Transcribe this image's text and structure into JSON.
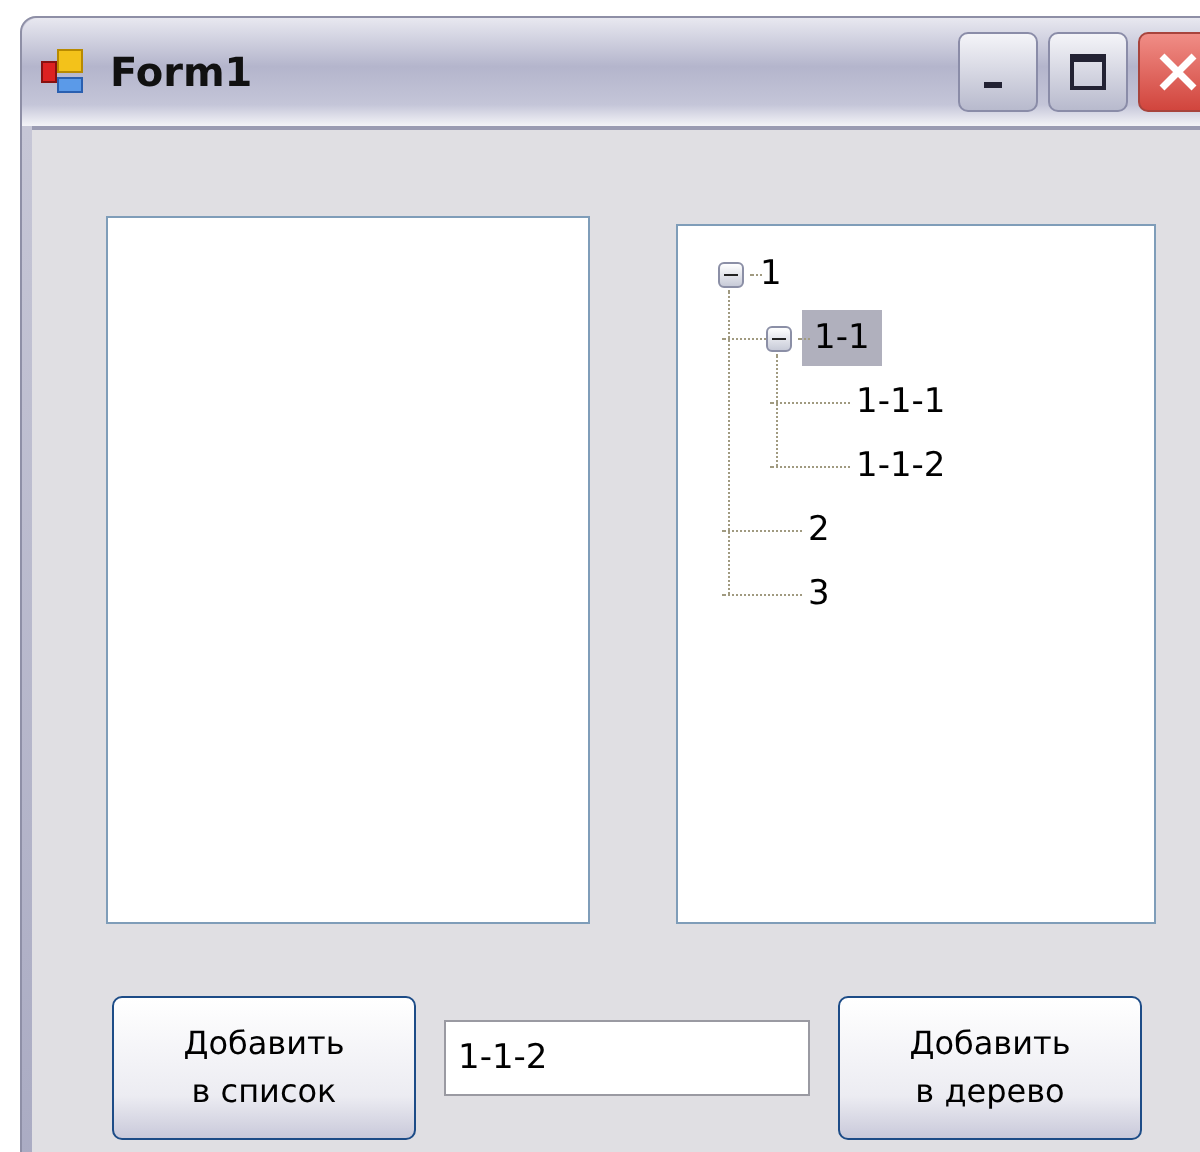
{
  "window": {
    "title": "Form1"
  },
  "tree_view": {
    "nodes": [
      {
        "label": "1",
        "expanded": true,
        "selected": false,
        "children": [
          {
            "label": "1-1",
            "expanded": true,
            "selected": true,
            "children": [
              {
                "label": "1-1-1",
                "selected": false
              },
              {
                "label": "1-1-2",
                "selected": false
              }
            ]
          },
          {
            "label": "2",
            "selected": false
          },
          {
            "label": "3",
            "selected": false
          }
        ]
      }
    ]
  },
  "add_to_list_button": {
    "label": "Добавить\nв список"
  },
  "text_field": {
    "value": "1-1-2"
  },
  "add_to_tree_button": {
    "label": "Добавить\nв дерево"
  }
}
